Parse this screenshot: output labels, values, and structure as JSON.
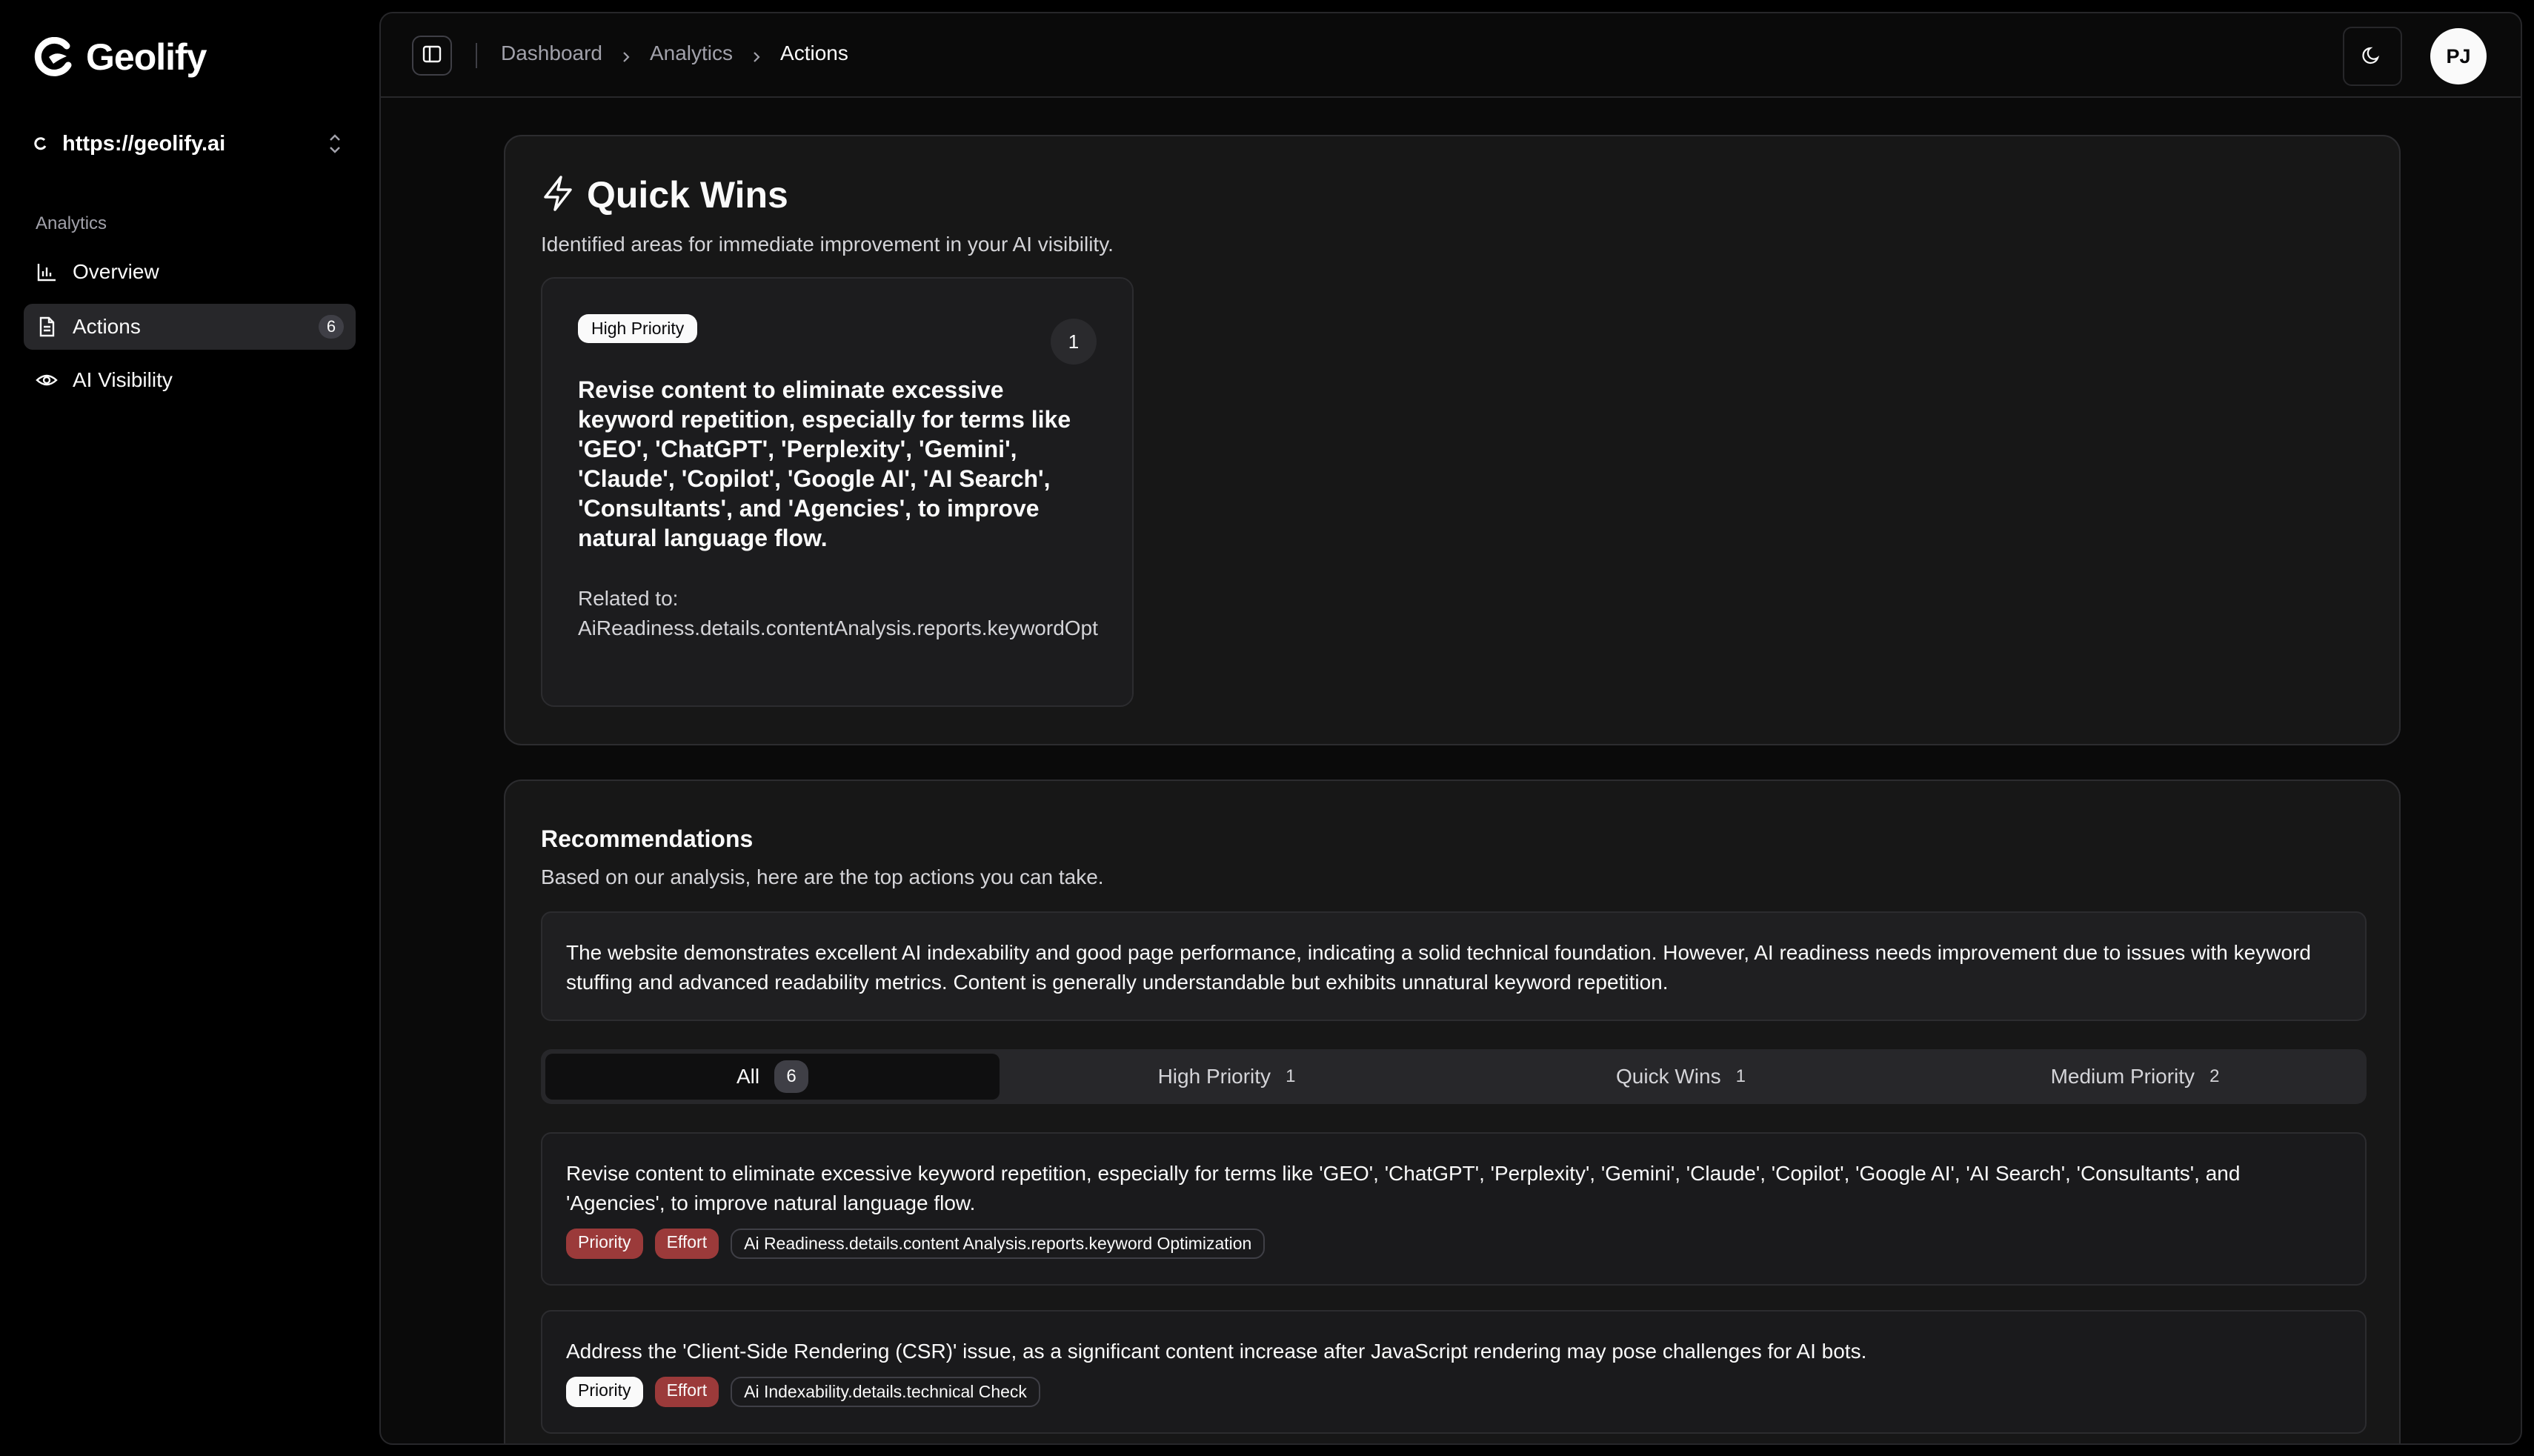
{
  "app": {
    "name": "Geolify"
  },
  "site": {
    "url": "https://geolify.ai"
  },
  "nav": {
    "group_label": "Analytics",
    "items": [
      {
        "label": "Overview",
        "icon": "bar-chart-icon"
      },
      {
        "label": "Actions",
        "icon": "file-text-icon",
        "badge": "6",
        "active": true
      },
      {
        "label": "AI Visibility",
        "icon": "eye-icon"
      }
    ]
  },
  "breadcrumb": [
    "Dashboard",
    "Analytics",
    "Actions"
  ],
  "user": {
    "initials": "PJ"
  },
  "quick_wins": {
    "title": "Quick Wins",
    "subtitle": "Identified areas for immediate improvement in your AI visibility.",
    "item": {
      "badge": "High Priority",
      "number": "1",
      "text": "Revise content to eliminate excessive keyword repetition, especially for terms like 'GEO', 'ChatGPT', 'Perplexity', 'Gemini', 'Claude', 'Copilot', 'Google AI', 'AI Search', 'Consultants', and 'Agencies', to improve natural language flow.",
      "related_label": "Related to:",
      "related_value": "AiReadiness.details.contentAnalysis.reports.keywordOpt"
    }
  },
  "recommendations": {
    "title": "Recommendations",
    "subtitle": "Based on our analysis, here are the top actions you can take.",
    "summary": "The website demonstrates excellent AI indexability and good page performance, indicating a solid technical foundation. However, AI readiness needs improvement due to issues with keyword stuffing and advanced readability metrics. Content is generally understandable but exhibits unnatural keyword repetition.",
    "tabs": [
      {
        "label": "All",
        "count": "6",
        "active": true
      },
      {
        "label": "High Priority",
        "count": "1"
      },
      {
        "label": "Quick Wins",
        "count": "1"
      },
      {
        "label": "Medium Priority",
        "count": "2"
      }
    ],
    "items": [
      {
        "text": "Revise content to eliminate excessive keyword repetition, especially for terms like 'GEO', 'ChatGPT', 'Perplexity', 'Gemini', 'Claude', 'Copilot', 'Google AI', 'AI Search', 'Consultants', and 'Agencies', to improve natural language flow.",
        "priority": "Priority",
        "effort": "Effort",
        "tag": "Ai Readiness.details.content Analysis.reports.keyword Optimization"
      },
      {
        "text": "Address the 'Client-Side Rendering (CSR)' issue, as a significant content increase after JavaScript rendering may pose challenges for AI bots.",
        "priority": "Priority",
        "effort": "Effort",
        "tag": "Ai Indexability.details.technical Check"
      }
    ]
  },
  "colors": {
    "background": "#000000",
    "panel": "#171717",
    "border": "#2c2c2f",
    "muted_text": "#a1a1aa",
    "red_tag": "#9b3a3a"
  }
}
